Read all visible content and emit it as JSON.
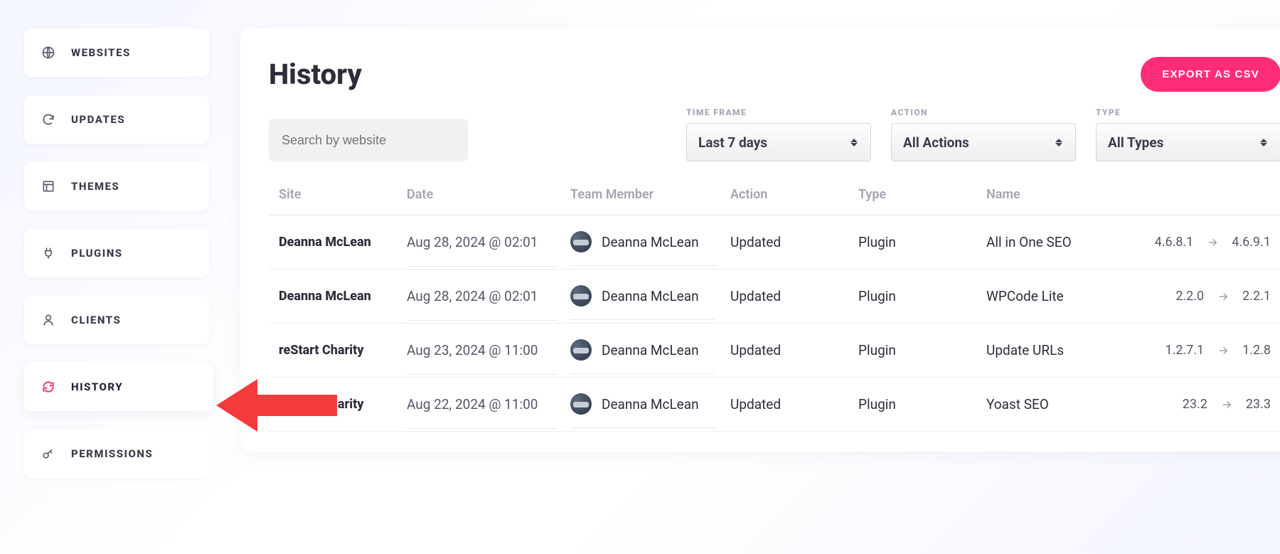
{
  "sidebar": {
    "items": [
      {
        "id": "websites",
        "label": "WEBSITES",
        "icon": "globe-icon"
      },
      {
        "id": "updates",
        "label": "UPDATES",
        "icon": "refresh-icon"
      },
      {
        "id": "themes",
        "label": "THEMES",
        "icon": "layout-icon"
      },
      {
        "id": "plugins",
        "label": "PLUGINS",
        "icon": "plug-icon"
      },
      {
        "id": "clients",
        "label": "CLIENTS",
        "icon": "person-icon"
      },
      {
        "id": "history",
        "label": "HISTORY",
        "icon": "refresh-icon"
      },
      {
        "id": "permissions",
        "label": "PERMISSIONS",
        "icon": "key-icon"
      }
    ],
    "active": "history"
  },
  "header": {
    "title": "History",
    "export_label": "EXPORT AS CSV"
  },
  "filters": {
    "search_placeholder": "Search by website",
    "timeframe": {
      "label": "TIME FRAME",
      "value": "Last 7 days"
    },
    "action": {
      "label": "ACTION",
      "value": "All Actions"
    },
    "type": {
      "label": "TYPE",
      "value": "All Types"
    }
  },
  "table": {
    "columns": {
      "site": "Site",
      "date": "Date",
      "team_member": "Team Member",
      "action": "Action",
      "type": "Type",
      "name": "Name"
    },
    "rows": [
      {
        "site": "Deanna McLean",
        "date": "Aug 28, 2024 @ 02:01",
        "member": "Deanna McLean",
        "action": "Updated",
        "type": "Plugin",
        "name": "All in One SEO",
        "from": "4.6.8.1",
        "to": "4.6.9.1"
      },
      {
        "site": "Deanna McLean",
        "date": "Aug 28, 2024 @ 02:01",
        "member": "Deanna McLean",
        "action": "Updated",
        "type": "Plugin",
        "name": "WPCode Lite",
        "from": "2.2.0",
        "to": "2.2.1"
      },
      {
        "site": "reStart Charity",
        "date": "Aug 23, 2024 @ 11:00",
        "member": "Deanna McLean",
        "action": "Updated",
        "type": "Plugin",
        "name": "Update URLs",
        "from": "1.2.7.1",
        "to": "1.2.8"
      },
      {
        "site": "reStart Charity",
        "date": "Aug 22, 2024 @ 11:00",
        "member": "Deanna McLean",
        "action": "Updated",
        "type": "Plugin",
        "name": "Yoast SEO",
        "from": "23.2",
        "to": "23.3"
      }
    ]
  },
  "colors": {
    "accent": "#ff2d78"
  }
}
